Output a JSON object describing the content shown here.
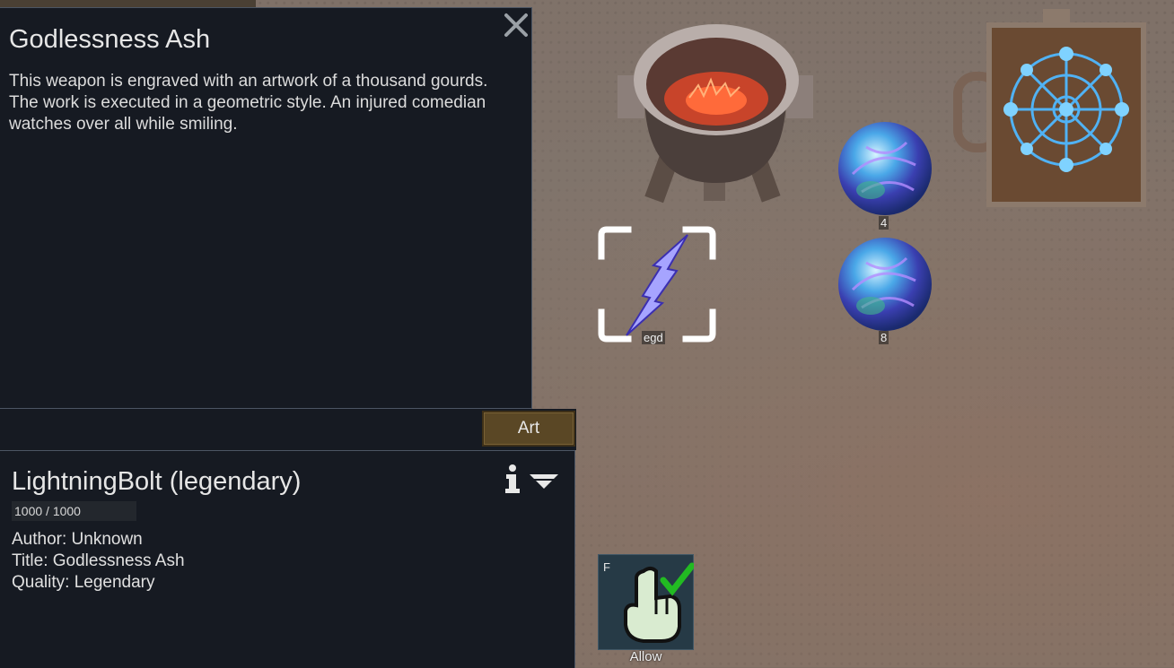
{
  "art_panel": {
    "title": "Godlessness Ash",
    "description": "This weapon is engraved with an artwork of a thousand gourds. The work is executed in a geometric style. An injured comedian watches over all while smiling.",
    "close_icon": "close-icon",
    "tab_label": "Art"
  },
  "inspect_pane": {
    "title": "LightningBolt (legendary)",
    "hit_points": "1000 / 1000",
    "author": "Author: Unknown",
    "item_title": "Title: Godlessness Ash",
    "quality": "Quality: Legendary",
    "info_icon": "info-icon",
    "collapse_icon": "collapse-chevron-icon"
  },
  "world": {
    "selected_item_label": "egd",
    "orb_top_count": "4",
    "orb_bottom_count": "8"
  },
  "command": {
    "hotkey": "F",
    "label": "Allow"
  }
}
